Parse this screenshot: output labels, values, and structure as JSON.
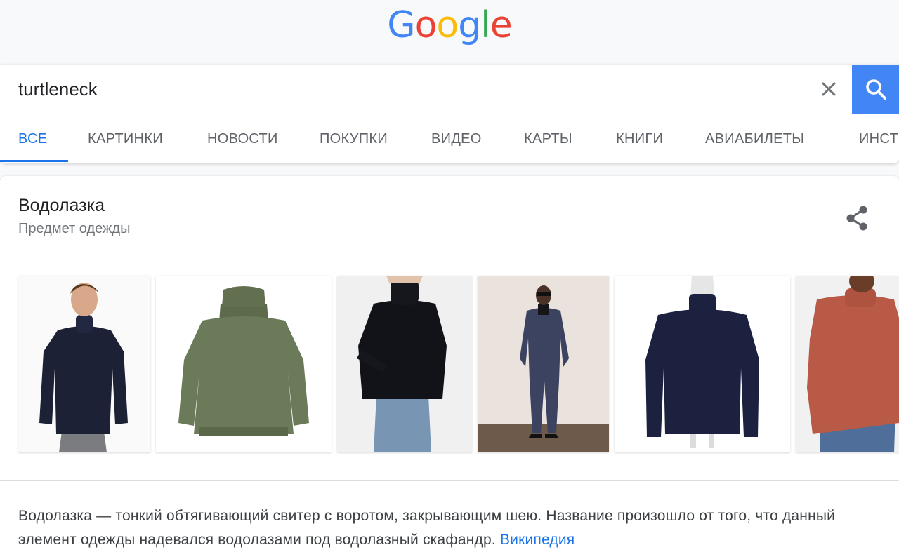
{
  "logo": {
    "letters": [
      {
        "char": "G",
        "color": "#4285F4"
      },
      {
        "char": "o",
        "color": "#EA4335"
      },
      {
        "char": "o",
        "color": "#FBBC05"
      },
      {
        "char": "g",
        "color": "#4285F4"
      },
      {
        "char": "l",
        "color": "#34A853"
      },
      {
        "char": "e",
        "color": "#EA4335"
      }
    ]
  },
  "search": {
    "query": "turtleneck",
    "clear_icon": "close-icon",
    "search_icon": "search-icon",
    "accent": "#4285F4"
  },
  "tabs": [
    {
      "label": "ВСЕ",
      "active": true
    },
    {
      "label": "КАРТИНКИ",
      "active": false
    },
    {
      "label": "НОВОСТИ",
      "active": false
    },
    {
      "label": "ПОКУПКИ",
      "active": false
    },
    {
      "label": "ВИДЕО",
      "active": false
    },
    {
      "label": "КАРТЫ",
      "active": false
    },
    {
      "label": "КНИГИ",
      "active": false
    },
    {
      "label": "АВИАБИЛЕТЫ",
      "active": false
    },
    {
      "label": "ИНСТ",
      "active": false
    }
  ],
  "knowledge_panel": {
    "title": "Водолазка",
    "subtitle": "Предмет одежды",
    "share_icon": "share-icon",
    "images": [
      {
        "name": "man-navy-turtleneck"
      },
      {
        "name": "olive-knit-sweater"
      },
      {
        "name": "woman-black-turtleneck"
      },
      {
        "name": "man-suit-turtleneck"
      },
      {
        "name": "navy-turtleneck-mannequin"
      },
      {
        "name": "woman-rust-turtleneck"
      }
    ],
    "description": "Водолазка — тонкий обтягивающий свитер с воротом, закрывающим шею. Название произошло от того, что данный элемент одежды надевался водолазами под водолазный скафандр.",
    "source_link": "Википедия"
  }
}
